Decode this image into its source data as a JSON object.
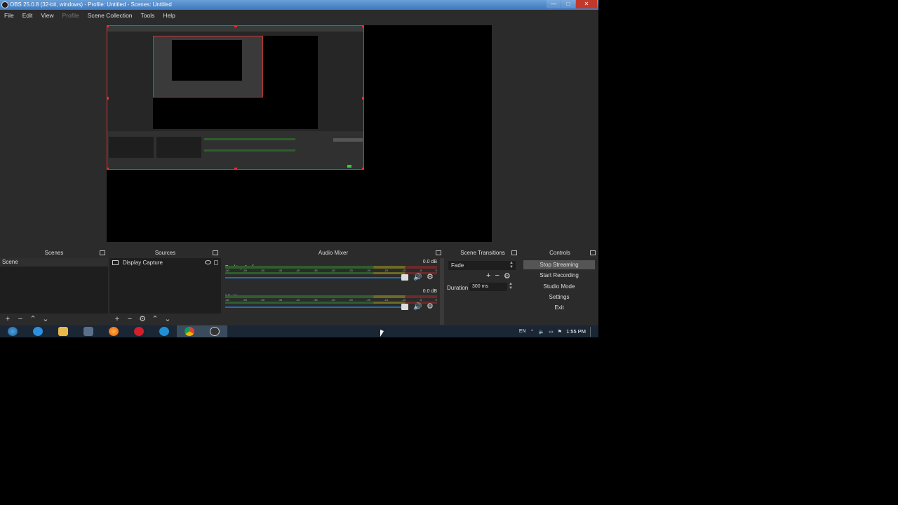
{
  "window": {
    "title": "OBS 25.0.8 (32-bit, windows) - Profile: Untitled - Scenes: Untitled",
    "minimize": "—",
    "maximize": "□",
    "close": "✕"
  },
  "menu": [
    {
      "label": "File",
      "disabled": false
    },
    {
      "label": "Edit",
      "disabled": false
    },
    {
      "label": "View",
      "disabled": false
    },
    {
      "label": "Profile",
      "disabled": true
    },
    {
      "label": "Scene Collection",
      "disabled": false
    },
    {
      "label": "Tools",
      "disabled": false
    },
    {
      "label": "Help",
      "disabled": false
    }
  ],
  "scenes": {
    "title": "Scenes",
    "items": [
      "Scene"
    ]
  },
  "sources": {
    "title": "Sources",
    "items": [
      "Display Capture"
    ]
  },
  "mixer": {
    "title": "Audio Mixer",
    "ticks": [
      "-60",
      "-55",
      "-50",
      "-45",
      "-40",
      "-35",
      "-30",
      "-25",
      "-20",
      "-15",
      "-10",
      "-5",
      "0"
    ],
    "channels": [
      {
        "name": "Desktop Audio",
        "db": "0.0 dB",
        "level": 1.0
      },
      {
        "name": "Mic/Aux",
        "db": "0.0 dB",
        "level": 1.0
      }
    ]
  },
  "transitions": {
    "title": "Scene Transitions",
    "selected": "Fade",
    "duration_label": "Duration",
    "duration_value": "300 ms"
  },
  "controls": {
    "title": "Controls",
    "buttons": [
      "Stop Streaming",
      "Start Recording",
      "Studio Mode",
      "Settings",
      "Exit"
    ]
  },
  "taskbar": {
    "lang": "EN",
    "time": "1:55 PM"
  }
}
